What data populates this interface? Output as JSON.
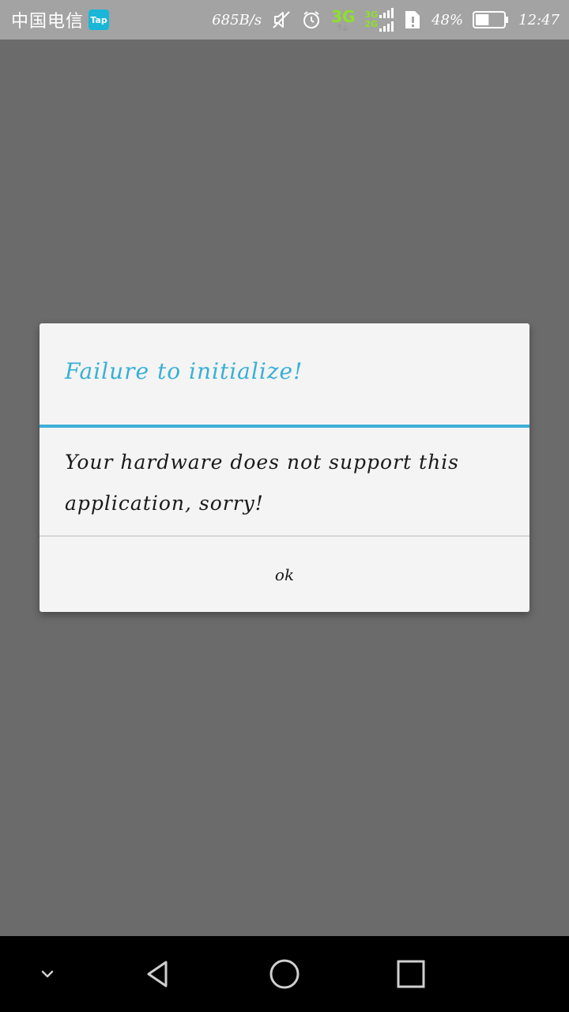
{
  "status_bar": {
    "carrier": "中国电信",
    "app_badge": "Tap",
    "net_speed": "685B/s",
    "network_type": "3G",
    "dual_top": "3G",
    "dual_bottom": "2G",
    "battery_percent": "48%",
    "battery_level": 0.48,
    "time": "12:47",
    "icons": [
      "tap-app-icon",
      "mute-icon",
      "alarm-icon",
      "signal-icon",
      "sim-icon",
      "battery-icon"
    ]
  },
  "dialog": {
    "title": "Failure to initialize!",
    "message": "Your hardware does not support this application, sorry!",
    "ok_label": "ok"
  },
  "nav_bar": {
    "icons": [
      "chevron-down-icon",
      "back-icon",
      "home-icon",
      "recents-icon"
    ]
  },
  "colors": {
    "accent": "#3db0d8",
    "status_bar": "#a3a3a3",
    "scrim": "#6b6b6b",
    "network_green": "#8fe02a",
    "badge": "#19b6d8"
  }
}
